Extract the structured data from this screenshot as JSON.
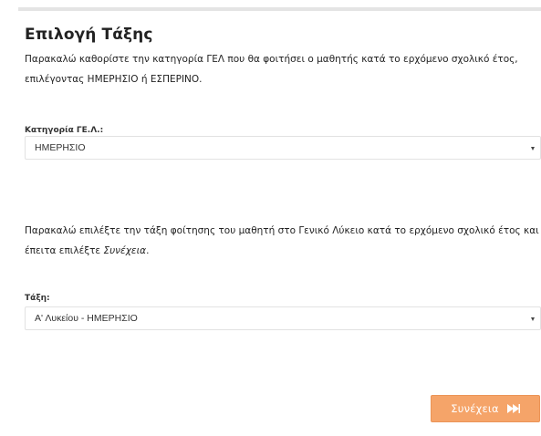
{
  "title": "Επιλογή Τάξης",
  "intro": {
    "text": "Παρακαλώ καθορίστε την κατηγορία ΓΕΛ που θα φοιτήσει ο μαθητής κατά το ερχόμενο σχολικό έτος, επιλέγοντας ΗΜΕΡΗΣΙΟ ή ΕΣΠΕΡΙΝΟ."
  },
  "category_field": {
    "label": "Κατηγορία ΓΕ.Λ.:",
    "value": "ΗΜΕΡΗΣΙΟ"
  },
  "class_instructions": {
    "text_before": "Παρακαλώ επιλέξτε την τάξη φοίτησης του μαθητή στο Γενικό Λύκειο κατά το ερχόμενο σχολικό έτος και έπειτα επιλέξτε ",
    "emphasis": "Συνέχεια",
    "text_after": "."
  },
  "class_field": {
    "label": "Τάξη:",
    "value": "Α' Λυκείου - ΗΜΕΡΗΣΙΟ"
  },
  "continue_button": {
    "label": "Συνέχεια",
    "icon": "fast-forward-icon"
  },
  "colors": {
    "accent": "#f5a469",
    "text": "#222222",
    "border": "#e2e2e2"
  }
}
